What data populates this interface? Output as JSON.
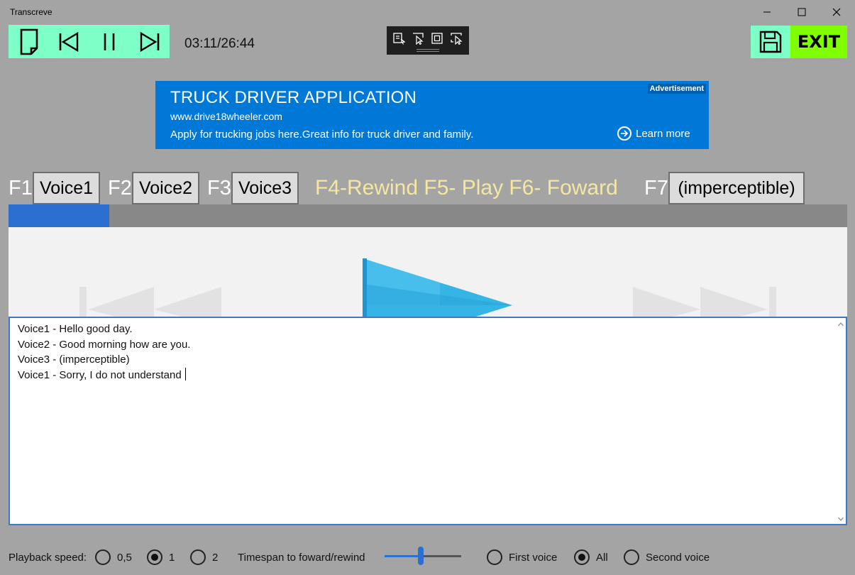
{
  "window": {
    "title": "Transcreve"
  },
  "player": {
    "time": "03:11/26:44",
    "progress_fraction": 0.12
  },
  "toolbar": {
    "exit_label": "EXIT"
  },
  "ad": {
    "title": "TRUCK DRIVER APPLICATION",
    "url": "www.drive18wheeler.com",
    "description": "Apply for trucking jobs here.Great info for truck driver and family.",
    "badge": "Advertisement",
    "learn_more": "Learn more"
  },
  "voices": {
    "f1": "F1",
    "voice1": "Voice1",
    "f2": "F2",
    "voice2": "Voice2",
    "f3": "F3",
    "voice3": "Voice3",
    "shortcut_hint": "F4-Rewind  F5- Play  F6- Foward",
    "f7": "F7",
    "f7_label": "(imperceptible)"
  },
  "transcript": {
    "lines": [
      "Voice1 - Hello good day.",
      "Voice2 - Good morning how are you.",
      "Voice3 - (imperceptible)",
      "Voice1 - Sorry, I do not understand"
    ]
  },
  "bottom": {
    "speed_label": "Playback speed:",
    "speed_options": [
      "0,5",
      "1",
      "2"
    ],
    "speed_selected": "1",
    "timespan_label": "Timespan to foward/rewind",
    "timespan_fraction": 0.47,
    "voice_options": [
      "First voice",
      "All",
      "Second voice"
    ],
    "voice_selected": "All"
  },
  "colors": {
    "accent": "#2b6fd0",
    "player_panel": "#7fffc8",
    "exit": "#80ff00",
    "ad": "#0078d7",
    "hint": "#f5e6a0"
  }
}
